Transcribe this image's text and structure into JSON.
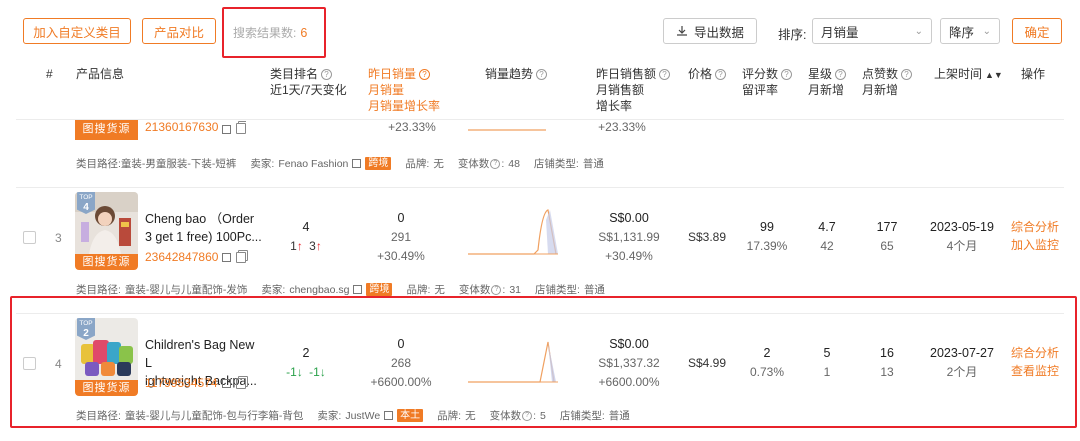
{
  "toolbar": {
    "add_category": "加入自定义类目",
    "compare": "产品对比",
    "result_label": "搜索结果数:",
    "result_count": "6",
    "export": "导出数据",
    "sort_label": "排序:",
    "sort_value": "月销量",
    "order_value": "降序",
    "confirm": "确定"
  },
  "columns": {
    "num": "#",
    "product_info": "产品信息",
    "category_rank": "类目排名",
    "category_rank_sub": "近1天/7天变化",
    "yesterday_sales": "昨日销量",
    "monthly_sales": "月销量",
    "monthly_sales_growth": "月销量增长率",
    "sales_trend": "销量趋势",
    "yesterday_revenue": "昨日销售额",
    "monthly_revenue": "月销售额",
    "growth_rate": "增长率",
    "price": "价格",
    "review_count": "评分数",
    "review_rate": "留评率",
    "star": "星级",
    "monthly_new": "月新增",
    "likes": "点赞数",
    "likes_monthly_new": "月新增",
    "listed_time": "上架时间"
  },
  "header_action": "操作",
  "partial_row": {
    "source_label": "图搜货源",
    "product_id": "21360167630",
    "monthly_growth": "+23.33%",
    "revenue_growth": "+23.33%",
    "path_label": "类目路径:",
    "path": "童装-男童服装-下装-短裤",
    "seller_label": "卖家:",
    "seller": "Fenao Fashion",
    "seller_tag": "跨境",
    "brand_label": "品牌:",
    "brand": "无",
    "variants_label": "变体数",
    "variants": "48",
    "store_type_label": "店铺类型:",
    "store_type": "普通"
  },
  "rows": [
    {
      "index": "3",
      "top_label": "TOP",
      "top_rank": "4",
      "source_label": "图搜货源",
      "title_line1": "Cheng bao （Order",
      "title_line2": "3 get 1 free) 100Pc...",
      "product_id": "23642847860",
      "rank": "4",
      "rank_d1": "1",
      "rank_d7": "3",
      "yesterday_sales": "0",
      "monthly_sales": "291",
      "monthly_growth": "+30.49%",
      "yesterday_revenue": "S$0.00",
      "monthly_revenue": "S$1,131.99",
      "revenue_growth": "+30.49%",
      "price": "S$3.89",
      "review_count": "99",
      "review_rate": "17.39%",
      "star": "4.7",
      "star_new": "42",
      "likes": "177",
      "likes_new": "65",
      "listed_date": "2023-05-19",
      "listed_age": "4个月",
      "action1": "综合分析",
      "action2": "加入监控",
      "path_label": "类目路径:",
      "path": "童装-婴儿与儿童配饰-发饰",
      "seller_label": "卖家:",
      "seller": "chengbao.sg",
      "seller_tag": "跨境",
      "brand_label": "品牌:",
      "brand": "无",
      "variants_label": "变体数",
      "variants": "31",
      "store_type_label": "店铺类型:",
      "store_type": "普通"
    },
    {
      "index": "4",
      "top_label": "TOP",
      "top_rank": "2",
      "source_label": "图搜货源",
      "title_line1": "Children's Bag New L",
      "title_line2": "ightweight Backpa...",
      "product_id": "11799534574",
      "rank": "2",
      "rank_d1": "-1",
      "rank_d7": "-1",
      "yesterday_sales": "0",
      "monthly_sales": "268",
      "monthly_growth": "+6600.00%",
      "yesterday_revenue": "S$0.00",
      "monthly_revenue": "S$1,337.32",
      "revenue_growth": "+6600.00%",
      "price": "S$4.99",
      "review_count": "2",
      "review_rate": "0.73%",
      "star": "5",
      "star_new": "1",
      "likes": "16",
      "likes_new": "13",
      "listed_date": "2023-07-27",
      "listed_age": "2个月",
      "action1": "综合分析",
      "action2": "查看监控",
      "path_label": "类目路径:",
      "path": "童装-婴儿与儿童配饰-包与行李箱-背包",
      "seller_label": "卖家:",
      "seller": "JustWe",
      "seller_tag": "本土",
      "brand_label": "品牌:",
      "brand": "无",
      "variants_label": "变体数",
      "variants": "5",
      "store_type_label": "店铺类型:",
      "store_type": "普通"
    }
  ],
  "colors": {
    "accent": "#f07b25",
    "highlight_frame": "#e8232b",
    "up": "#e8232b",
    "down": "#2aa14a"
  }
}
